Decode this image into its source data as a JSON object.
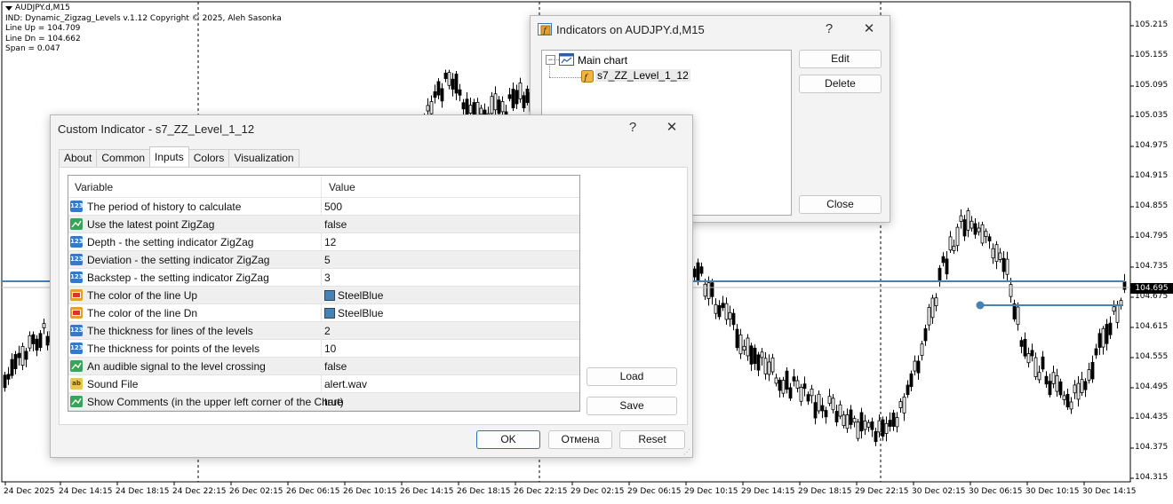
{
  "chart": {
    "symbol": "AUDJPY.d,M15",
    "indicator_line": "IND: Dynamic_Zigzag_Levels v.1.12 Copyright © 2025, Aleh Sasonka",
    "line_up": "Line Up = 104.709",
    "line_dn": "Line Dn = 104.662",
    "span": "Span = 0.047",
    "current_price": "104.695",
    "price_axis": [
      "105.215",
      "105.155",
      "105.095",
      "105.035",
      "104.975",
      "104.915",
      "104.855",
      "104.795",
      "104.735",
      "104.675",
      "104.615",
      "104.555",
      "104.495",
      "104.435",
      "104.375",
      "104.315"
    ],
    "time_axis": [
      "24 Dec 2025",
      "24 Dec 14:15",
      "24 Dec 18:15",
      "24 Dec 22:15",
      "26 Dec 02:15",
      "26 Dec 06:15",
      "26 Dec 10:15",
      "26 Dec 14:15",
      "26 Dec 18:15",
      "26 Dec 22:15",
      "29 Dec 02:15",
      "29 Dec 06:15",
      "29 Dec 10:15",
      "29 Dec 14:15",
      "29 Dec 18:15",
      "29 Dec 22:15",
      "30 Dec 02:15",
      "30 Dec 06:15",
      "30 Dec 10:15",
      "30 Dec 14:15"
    ],
    "colors": {
      "level_line": "#4682B4",
      "candle": "#000000",
      "background": "#ffffff"
    }
  },
  "indicators_dialog": {
    "title": "Indicators on AUDJPY.d,M15",
    "help": "?",
    "close_x": "✕",
    "tree_root": "Main chart",
    "tree_child": "s7_ZZ_Level_1_12",
    "edit": "Edit",
    "delete": "Delete",
    "close": "Close"
  },
  "custom_dialog": {
    "title": "Custom Indicator - s7_ZZ_Level_1_12",
    "help": "?",
    "close_x": "✕",
    "tabs": [
      "About",
      "Common",
      "Inputs",
      "Colors",
      "Visualization"
    ],
    "active_tab": "Inputs",
    "col_variable": "Variable",
    "col_value": "Value",
    "rows": [
      {
        "type": "num",
        "icon": "123",
        "variable": "The period of history to calculate",
        "value": "500"
      },
      {
        "type": "bool",
        "icon": "",
        "variable": "Use the latest point ZigZag",
        "value": "false"
      },
      {
        "type": "num",
        "icon": "123",
        "variable": "Depth - the setting indicator ZigZag",
        "value": "12"
      },
      {
        "type": "num",
        "icon": "123",
        "variable": "Deviation - the setting indicator ZigZag",
        "value": "5"
      },
      {
        "type": "num",
        "icon": "123",
        "variable": "Backstep - the setting indicator ZigZag",
        "value": "3"
      },
      {
        "type": "color",
        "icon": "",
        "variable": "The color of the line Up",
        "value": "SteelBlue",
        "swatch": "#4682B4"
      },
      {
        "type": "color",
        "icon": "",
        "variable": "The color of the line Dn",
        "value": "SteelBlue",
        "swatch": "#4682B4"
      },
      {
        "type": "num",
        "icon": "123",
        "variable": "The thickness for lines of the levels",
        "value": "2"
      },
      {
        "type": "num",
        "icon": "123",
        "variable": "The thickness for points of the levels",
        "value": "10"
      },
      {
        "type": "bool",
        "icon": "",
        "variable": "An audible signal to the level crossing",
        "value": "false"
      },
      {
        "type": "str",
        "icon": "ab",
        "variable": "Sound File",
        "value": "alert.wav"
      },
      {
        "type": "bool",
        "icon": "",
        "variable": "Show Comments (in the upper left corner of the Chart)",
        "value": "true"
      }
    ],
    "load": "Load",
    "save": "Save",
    "ok": "OK",
    "cancel": "Отмена",
    "reset": "Reset"
  }
}
